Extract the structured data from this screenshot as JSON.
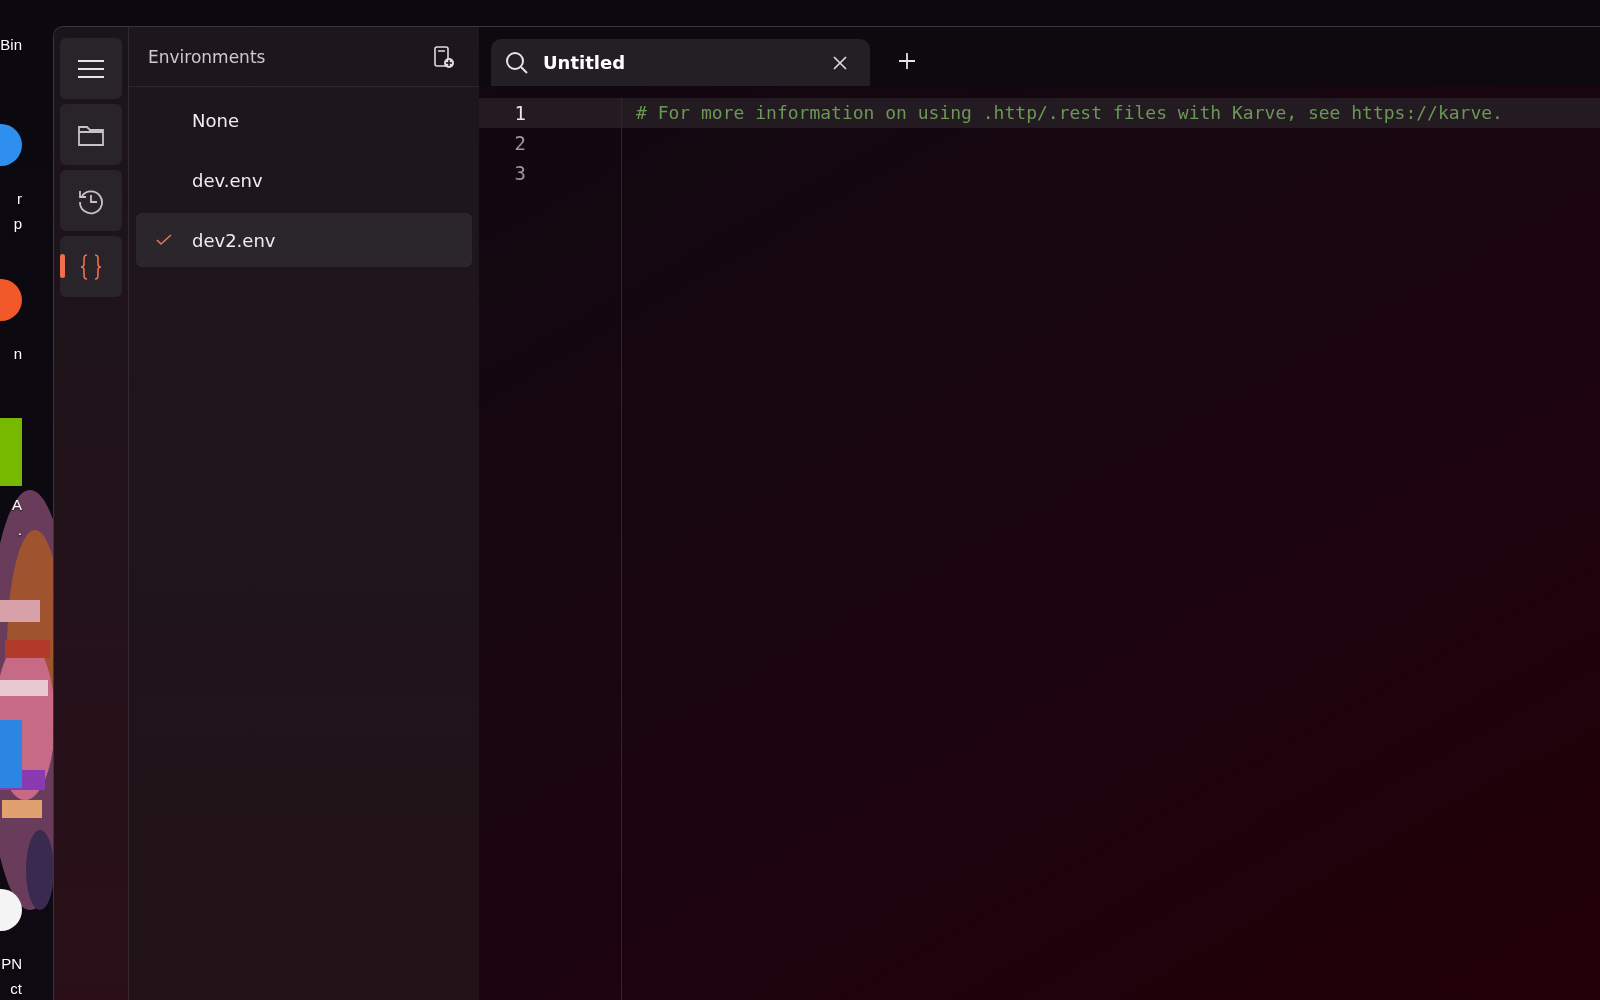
{
  "desktop": {
    "icons": [
      {
        "kind": "none",
        "lines": [
          "Bin"
        ]
      },
      {
        "kind": "circle",
        "color": "#2f8fef",
        "lines": [
          "r",
          "p"
        ]
      },
      {
        "kind": "circle",
        "color": "#f2592a",
        "lines": [
          "n"
        ]
      },
      {
        "kind": "square",
        "color": "#76b900",
        "lines": [
          "A",
          "."
        ]
      },
      {
        "kind": "square",
        "color": "#2a86e0"
      },
      {
        "kind": "circle",
        "color": "#f4f4f4",
        "lines": [
          "PN",
          "ct"
        ]
      }
    ]
  },
  "rail": [
    {
      "kind": "menu",
      "selected": false
    },
    {
      "kind": "folder",
      "selected": false
    },
    {
      "kind": "history",
      "selected": false
    },
    {
      "kind": "braces",
      "selected": true
    }
  ],
  "sidebar": {
    "title": "Environments",
    "items": [
      {
        "label": "None",
        "selected": false
      },
      {
        "label": "dev.env",
        "selected": false
      },
      {
        "label": "dev2.env",
        "selected": true
      }
    ]
  },
  "tabs": [
    {
      "title": "Untitled"
    }
  ],
  "editor": {
    "lines": [
      {
        "number": "1",
        "text": "# For more information on using .http/.rest files with Karve, see https://karve.",
        "current": true
      },
      {
        "number": "2",
        "current": false
      },
      {
        "number": "3",
        "current": false
      }
    ]
  }
}
